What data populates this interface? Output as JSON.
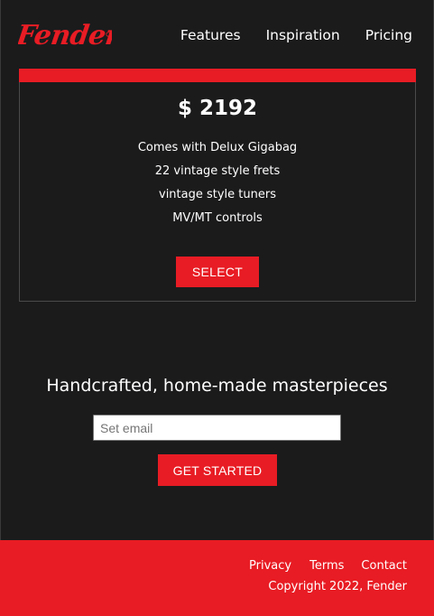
{
  "brand": {
    "logo_text": "Fender",
    "accent_color": "#e81c24"
  },
  "nav": {
    "features": "Features",
    "inspiration": "Inspiration",
    "pricing": "Pricing"
  },
  "pricing_card": {
    "price": "$ 2192",
    "features": [
      "Comes with Delux Gigabag",
      "22 vintage style frets",
      "vintage style tuners",
      "MV/MT controls"
    ],
    "select_label": "SELECT"
  },
  "signup": {
    "headline": "Handcrafted, home-made masterpieces",
    "email_placeholder": "Set email",
    "cta_label": "GET STARTED"
  },
  "footer": {
    "links": {
      "privacy": "Privacy",
      "terms": "Terms",
      "contact": "Contact"
    },
    "copyright": "Copyright 2022, Fender"
  }
}
